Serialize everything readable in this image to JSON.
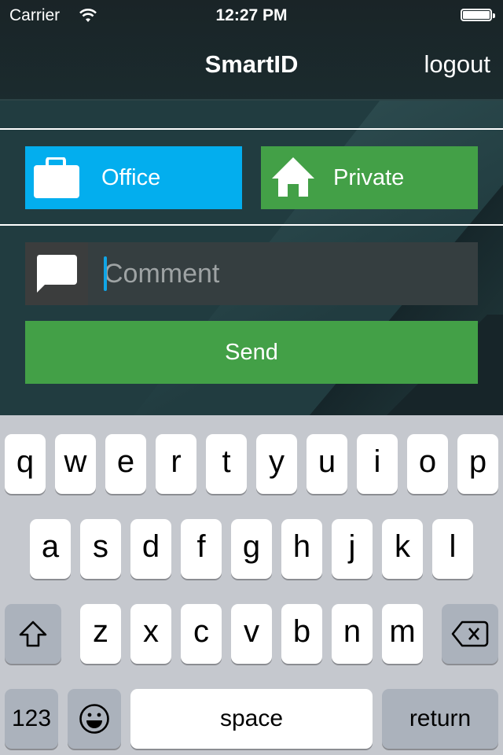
{
  "status_bar": {
    "carrier": "Carrier",
    "time": "12:27 PM",
    "wifi_icon": "wifi-icon",
    "battery_icon": "battery-full-icon"
  },
  "nav": {
    "title": "SmartID",
    "logout_label": "logout"
  },
  "type_buttons": {
    "office": {
      "label": "Office",
      "icon": "briefcase-icon",
      "color": "#03aeee"
    },
    "private": {
      "label": "Private",
      "icon": "home-icon",
      "color": "#43a047"
    }
  },
  "comment": {
    "icon": "speech-bubble-icon",
    "placeholder": "Comment",
    "value": ""
  },
  "send": {
    "label": "Send",
    "color": "#43a047"
  },
  "keyboard": {
    "row1": [
      "q",
      "w",
      "e",
      "r",
      "t",
      "y",
      "u",
      "i",
      "o",
      "p"
    ],
    "row2": [
      "a",
      "s",
      "d",
      "f",
      "g",
      "h",
      "j",
      "k",
      "l"
    ],
    "row3": [
      "z",
      "x",
      "c",
      "v",
      "b",
      "n",
      "m"
    ],
    "shift_icon": "shift-icon",
    "delete_icon": "backspace-icon",
    "numbers_label": "123",
    "emoji_icon": "emoji-icon",
    "space_label": "space",
    "return_label": "return"
  }
}
